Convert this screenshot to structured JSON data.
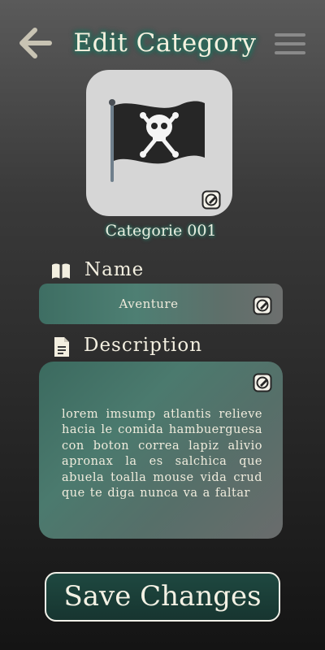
{
  "header": {
    "title": "Edit Category",
    "back_icon": "arrow-left-icon",
    "menu_icon": "hamburger-menu-icon"
  },
  "category": {
    "image_icon": "pirate-flag-icon",
    "label": "Categorie 001"
  },
  "name_section": {
    "icon": "book-open-icon",
    "label": "Name",
    "value": "Aventure"
  },
  "description_section": {
    "icon": "document-icon",
    "label": "Description",
    "value": "lorem imsump atlantis relieve hacia le comida hambuerguesa con boton correa lapiz alivio apronax la es salchica que abuela toalla mouse vida crud que te diga nunca va a faltar"
  },
  "actions": {
    "save_label": "Save Changes"
  },
  "colors": {
    "accent_glow": "#2e6a5c",
    "field_teal": "#4b7a6e",
    "save_bg": "#1e4840",
    "text_cream": "#f3efe0"
  }
}
